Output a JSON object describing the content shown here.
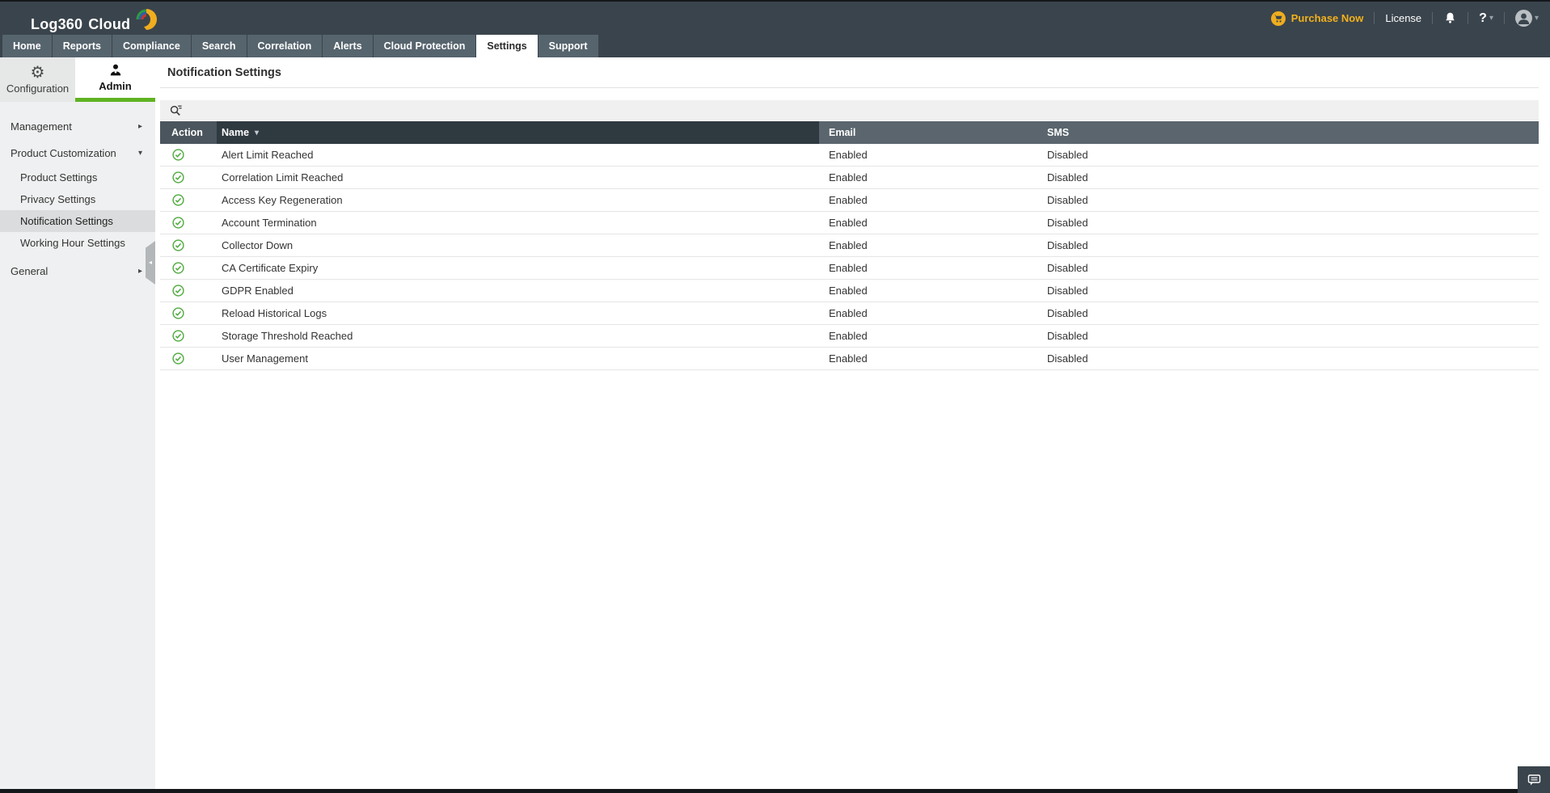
{
  "colors": {
    "topbar_bg": "#3a444c",
    "tab_bg": "#56646d",
    "accent_green": "#5fb321",
    "brand_yellow": "#efad1f",
    "purchase_text": "#f2b11d",
    "header_action_bg": "#4b555d",
    "header_name_bg": "#2f3940",
    "header_email_sms_bg": "#5a656d",
    "sidebar_bg": "#eff0f1",
    "sidebar_active_bg": "#dbdcdd",
    "check_green": "#4fa93e"
  },
  "topbar": {
    "logo_primary": "Log360",
    "logo_secondary": "Cloud",
    "purchase_label": "Purchase Now",
    "license_label": "License",
    "help_label": "?"
  },
  "nav": {
    "tabs": [
      {
        "label": "Home"
      },
      {
        "label": "Reports"
      },
      {
        "label": "Compliance"
      },
      {
        "label": "Search"
      },
      {
        "label": "Correlation"
      },
      {
        "label": "Alerts"
      },
      {
        "label": "Cloud Protection"
      },
      {
        "label": "Settings",
        "active": true
      },
      {
        "label": "Support"
      }
    ]
  },
  "left_tabs": {
    "configuration_label": "Configuration",
    "admin_label": "Admin"
  },
  "sidebar": {
    "items": [
      {
        "label": "Management",
        "level": 1,
        "chevron": "right"
      },
      {
        "label": "Product Customization",
        "level": 1,
        "chevron": "down",
        "expanded": true
      },
      {
        "label": "Product Settings",
        "level": 2
      },
      {
        "label": "Privacy Settings",
        "level": 2
      },
      {
        "label": "Notification Settings",
        "level": 2,
        "active": true
      },
      {
        "label": "Working Hour Settings",
        "level": 2
      },
      {
        "label": "General",
        "level": 1,
        "chevron": "right"
      }
    ]
  },
  "main": {
    "title": "Notification Settings",
    "table": {
      "headers": {
        "action": "Action",
        "name": "Name",
        "email": "Email",
        "sms": "SMS"
      },
      "rows": [
        {
          "action": "enabled-check",
          "name": "Alert Limit Reached",
          "email": "Enabled",
          "sms": "Disabled"
        },
        {
          "action": "enabled-check",
          "name": "Correlation Limit Reached",
          "email": "Enabled",
          "sms": "Disabled"
        },
        {
          "action": "enabled-check",
          "name": "Access Key Regeneration",
          "email": "Enabled",
          "sms": "Disabled"
        },
        {
          "action": "enabled-check",
          "name": "Account Termination",
          "email": "Enabled",
          "sms": "Disabled"
        },
        {
          "action": "enabled-check",
          "name": "Collector Down",
          "email": "Enabled",
          "sms": "Disabled"
        },
        {
          "action": "enabled-check",
          "name": "CA Certificate Expiry",
          "email": "Enabled",
          "sms": "Disabled"
        },
        {
          "action": "enabled-check",
          "name": "GDPR Enabled",
          "email": "Enabled",
          "sms": "Disabled"
        },
        {
          "action": "enabled-check",
          "name": "Reload Historical Logs",
          "email": "Enabled",
          "sms": "Disabled"
        },
        {
          "action": "enabled-check",
          "name": "Storage Threshold Reached",
          "email": "Enabled",
          "sms": "Disabled"
        },
        {
          "action": "enabled-check",
          "name": "User Management",
          "email": "Enabled",
          "sms": "Disabled"
        }
      ]
    }
  },
  "icons": {
    "gear": "⚙",
    "chevron_right": "▸",
    "chevron_down": "▾",
    "sort_caret": "▾",
    "dropdown_caret": "▾",
    "collapse_caret": "◂"
  }
}
